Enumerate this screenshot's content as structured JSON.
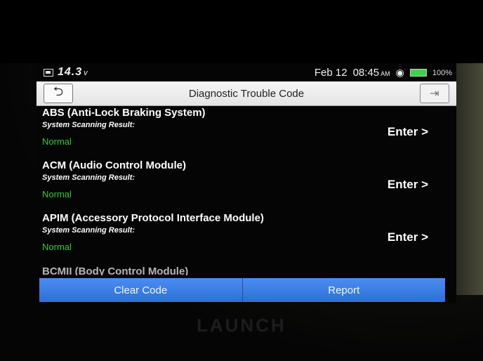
{
  "status_bar": {
    "voltage": "14.3",
    "voltage_unit": "v",
    "date": "Feb 12",
    "time": "08:45",
    "ampm": "AM",
    "battery_pct": "100%"
  },
  "title_bar": {
    "title": "Diagnostic Trouble Code"
  },
  "modules": [
    {
      "title": "ABS (Anti-Lock Braking System)",
      "subtitle": "System Scanning Result:",
      "status": "Normal",
      "action": "Enter >"
    },
    {
      "title": "ACM (Audio Control Module)",
      "subtitle": "System Scanning Result:",
      "status": "Normal",
      "action": "Enter >"
    },
    {
      "title": "APIM (Accessory Protocol Interface Module)",
      "subtitle": "System Scanning Result:",
      "status": "Normal",
      "action": "Enter >"
    }
  ],
  "partial_row": {
    "title": "BCMII (Body Control Module)"
  },
  "bottom_bar": {
    "clear_label": "Clear Code",
    "report_label": "Report"
  },
  "device": {
    "brand": "LAUNCH"
  },
  "colors": {
    "status_normal": "#36c83a",
    "button_blue": "#3b7fe6",
    "battery": "#3fd14a"
  },
  "icons": {
    "back": "back-arrow-icon",
    "exit": "exit-icon",
    "wifi": "wifi-icon",
    "battery": "battery-icon"
  }
}
